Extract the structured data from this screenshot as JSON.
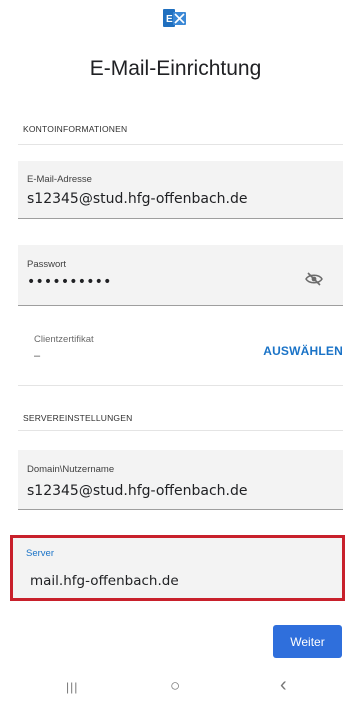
{
  "app": {
    "title": "E-Mail-Einrichtung",
    "logo_icon": "exchange-icon"
  },
  "sections": {
    "account": "KONTOINFORMATIONEN",
    "server": "SERVEREINSTELLUNGEN"
  },
  "fields": {
    "email": {
      "label": "E-Mail-Adresse",
      "value": "s12345@stud.hfg-offenbach.de"
    },
    "password": {
      "label": "Passwort",
      "value": "••••••••••",
      "toggle_icon": "eye-off-icon"
    },
    "certificate": {
      "label": "Clientzertifikat",
      "value": "–",
      "action": "AUSWÄHLEN"
    },
    "username": {
      "label": "Domain\\Nutzername",
      "value": "s12345@stud.hfg-offenbach.de"
    },
    "server": {
      "label": "Server",
      "value": "mail.hfg-offenbach.de",
      "highlight_color": "#c8202b"
    }
  },
  "actions": {
    "next": "Weiter"
  },
  "navbar": {
    "recents": "|||",
    "home": "○",
    "back": "‹"
  },
  "colors": {
    "accent": "#1a73c7",
    "button": "#2f6fdc",
    "highlight": "#c8202b"
  }
}
